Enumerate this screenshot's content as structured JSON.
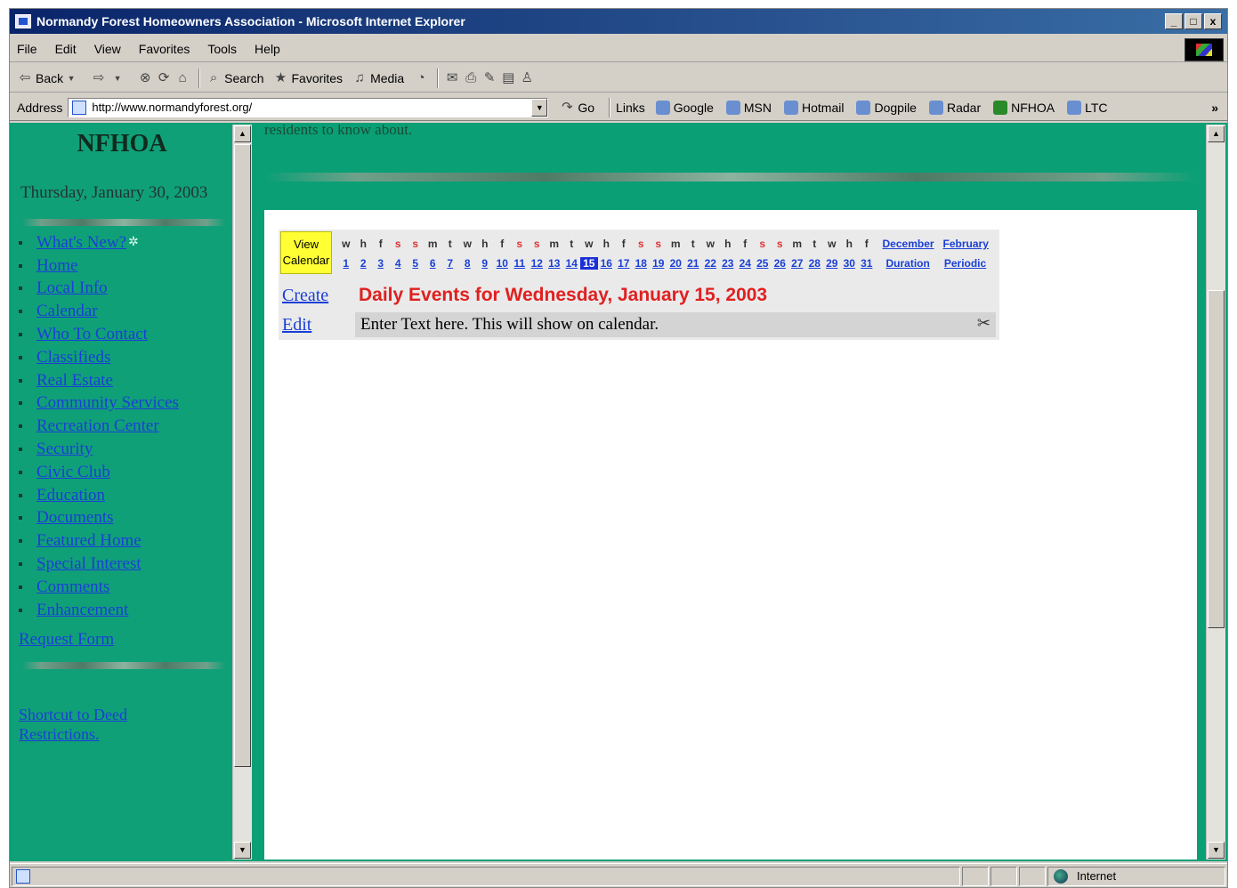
{
  "window": {
    "title": "Normandy Forest Homeowners Association - Microsoft Internet Explorer",
    "buttons": [
      "_",
      "□",
      "x"
    ]
  },
  "menu": [
    "File",
    "Edit",
    "View",
    "Favorites",
    "Tools",
    "Help"
  ],
  "toolbar": {
    "back": "Back",
    "search": "Search",
    "favorites": "Favorites",
    "media": "Media"
  },
  "address": {
    "label": "Address",
    "url": "http://www.normandyforest.org/",
    "go": "Go",
    "links_label": "Links",
    "links": [
      "Google",
      "MSN",
      "Hotmail",
      "Dogpile",
      "Radar",
      "NFHOA",
      "LTC"
    ],
    "more": "»"
  },
  "sidebar": {
    "title": "NFHOA",
    "date": "Thursday, January 30, 2003",
    "items": [
      {
        "label": "What's New?"
      },
      {
        "label": "Home"
      },
      {
        "label": "Local Info"
      },
      {
        "label": "Calendar"
      },
      {
        "label": "Who To Contact"
      },
      {
        "label": "Classifieds"
      },
      {
        "label": "Real Estate"
      },
      {
        "label": "Community Services"
      },
      {
        "label": "Recreation Center"
      },
      {
        "label": "Security"
      },
      {
        "label": "Civic Club"
      },
      {
        "label": "Education"
      },
      {
        "label": "Documents"
      },
      {
        "label": "Featured Home"
      },
      {
        "label": "Special Interest"
      },
      {
        "label": "Comments"
      },
      {
        "label": "Enhancement"
      }
    ],
    "request_form": "Request Form",
    "shortcut": "Shortcut to Deed Restrictions."
  },
  "main": {
    "top_text": "residents to know about.",
    "calendar": {
      "view_line1": "View",
      "view_line2": "Calendar",
      "day_letters": [
        "w",
        "h",
        "f",
        "s",
        "s",
        "m",
        "t",
        "w",
        "h",
        "f",
        "s",
        "s",
        "m",
        "t",
        "w",
        "h",
        "f",
        "s",
        "s",
        "m",
        "t",
        "w",
        "h",
        "f",
        "s",
        "s",
        "m",
        "t",
        "w",
        "h",
        "f"
      ],
      "days": [
        "1",
        "2",
        "3",
        "4",
        "5",
        "6",
        "7",
        "8",
        "9",
        "10",
        "11",
        "12",
        "13",
        "14",
        "15",
        "16",
        "17",
        "18",
        "19",
        "20",
        "21",
        "22",
        "23",
        "24",
        "25",
        "26",
        "27",
        "28",
        "29",
        "30",
        "31"
      ],
      "selected_day": "15",
      "prev_month": "December",
      "next_month": "February",
      "duration": "Duration",
      "periodic": "Periodic"
    },
    "create_label": "Create",
    "events_title": "Daily Events for Wednesday, January 15, 2003",
    "edit_label": "Edit",
    "event_text": "Enter Text here. This will show on calendar."
  },
  "status": {
    "zone": "Internet"
  },
  "colors": {
    "page_green": "#0a9f75",
    "link_blue": "#1a3fd6",
    "title_red": "#e02020",
    "highlight_yellow": "#ffff33"
  }
}
